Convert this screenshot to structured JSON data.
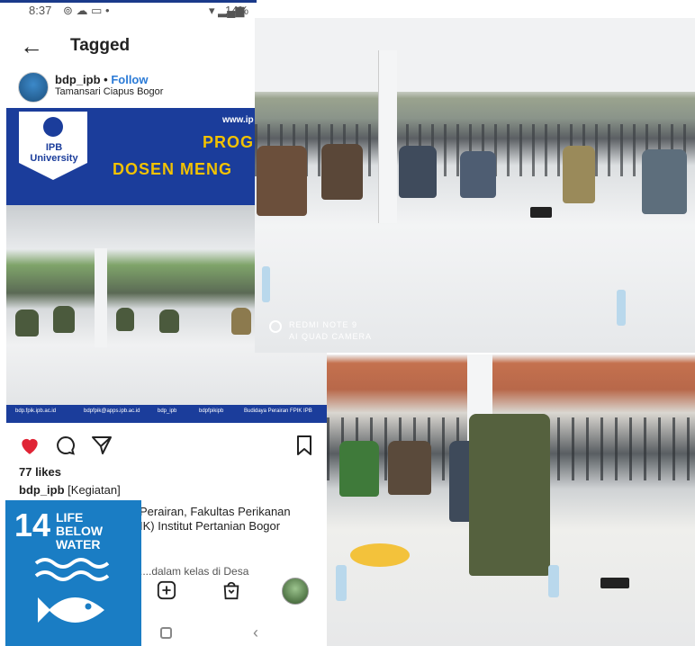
{
  "status": {
    "time": "8:37",
    "battery": "14%"
  },
  "header": {
    "title": "Tagged"
  },
  "post": {
    "account": "bdp_ipb",
    "separator": " • ",
    "follow": "Follow",
    "location": "Tamansari Ciapus Bogor",
    "banner": {
      "logo_text": "IPB University",
      "web": "www.ip",
      "line1": "PROG",
      "line2": "DOSEN MENG"
    },
    "footer_links": [
      "bdp.fpik.ipb.ac.id",
      "bdpfpik@apps.ipb.ac.id",
      "bdp_ipb",
      "bdpfpikipb",
      "Budidaya Perairan FPIK IPB"
    ],
    "likes": "77 likes",
    "caption_user": "bdp_ipb",
    "caption_text": "[Kegiatan]",
    "caption_line2": "Perairan, Fakultas Perikanan",
    "caption_line3": "IK) Institut Pertanian Bogor",
    "caption_line4": "....dalam kelas di Desa"
  },
  "sdg": {
    "number": "14",
    "label_line1": "LIFE",
    "label_line2": "BELOW WATER"
  },
  "photo_watermark": {
    "line1": "REDMI NOTE 9",
    "line2": "AI QUAD CAMERA"
  },
  "colors": {
    "instagram_blue": "#2a7ad6",
    "heart": "#e02435",
    "sdg_blue": "#1a7dc4",
    "banner_blue": "#1b3d9b"
  }
}
